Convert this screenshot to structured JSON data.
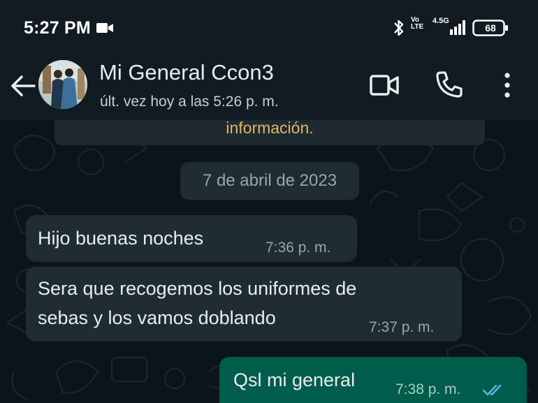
{
  "status_bar": {
    "time": "5:27 PM",
    "volte_top": "Vo",
    "volte_bottom": "LTE",
    "network": "4.5G",
    "battery": "68"
  },
  "header": {
    "contact_name": "Mi General Ccon3",
    "last_seen": "últ. vez hoy a las 5:26 p. m."
  },
  "chat": {
    "system_message": "información.",
    "date": "7 de abril de 2023",
    "messages": [
      {
        "direction": "in",
        "lines": [
          "Hijo buenas noches"
        ],
        "time": "7:36 p. m."
      },
      {
        "direction": "in",
        "lines": [
          "Sera que recogemos los uniformes de",
          "sebas y los vamos doblando"
        ],
        "time": "7:37 p. m."
      },
      {
        "direction": "out",
        "lines": [
          "Qsl mi general"
        ],
        "time": "7:38 p. m.",
        "status": "read"
      }
    ]
  },
  "colors": {
    "background": "#0b141a",
    "header": "#111b21",
    "incoming_bubble": "#202c33",
    "outgoing_bubble": "#005c4b",
    "read_ticks": "#53bdeb"
  }
}
